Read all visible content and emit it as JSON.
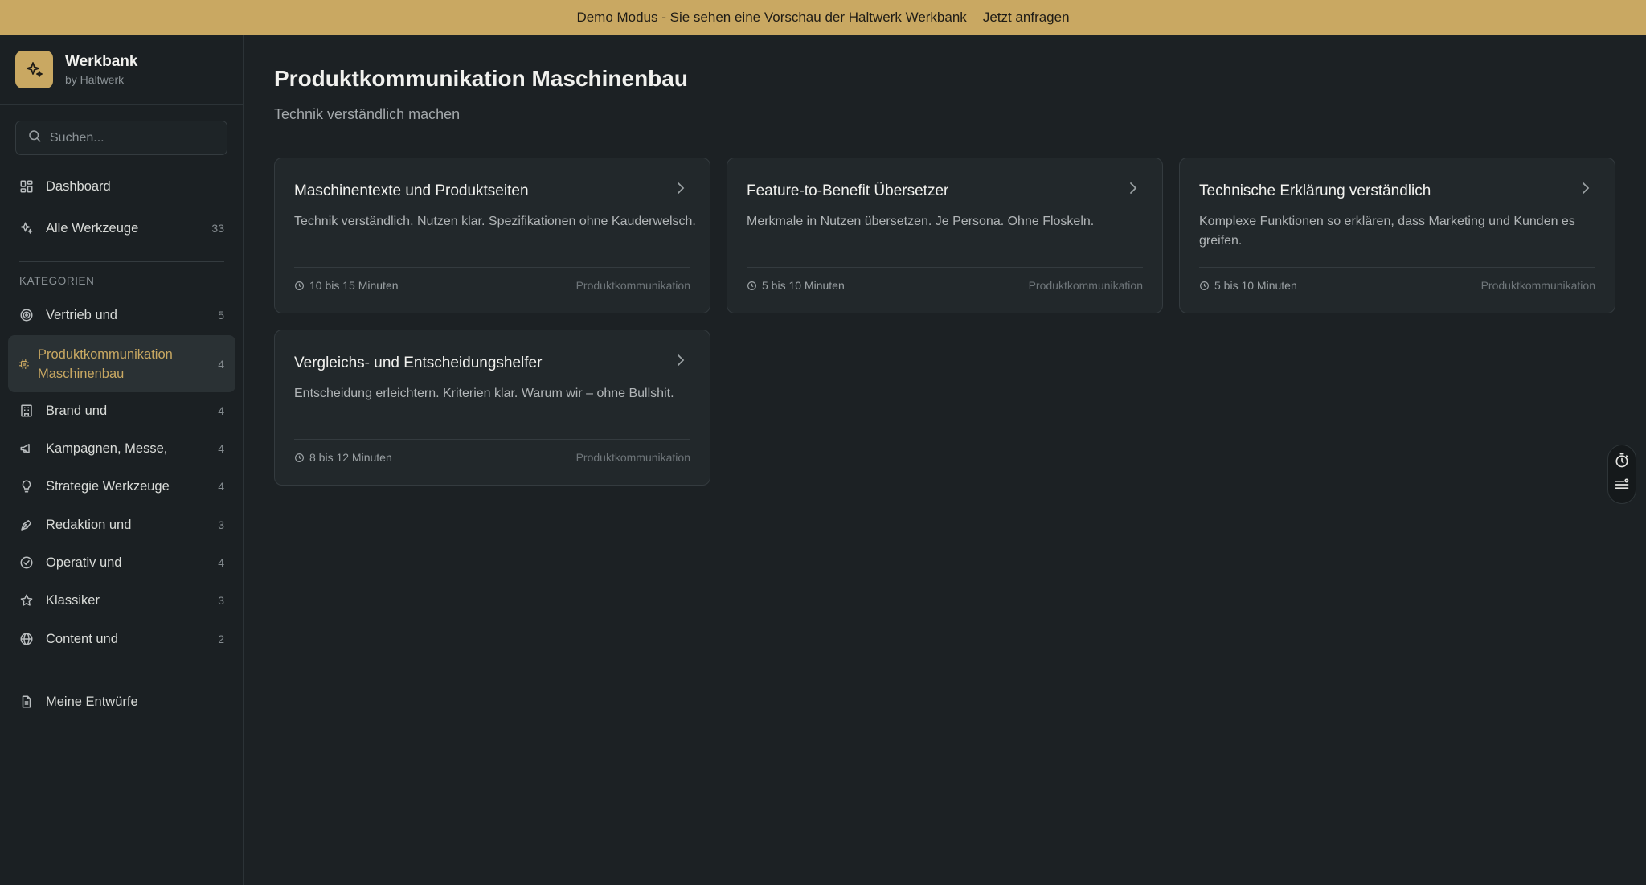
{
  "banner": {
    "text": "Demo Modus - Sie sehen eine Vorschau der Haltwerk Werkbank",
    "link": "Jetzt anfragen"
  },
  "brand": {
    "name": "Werkbank",
    "sub": "by Haltwerk"
  },
  "search": {
    "placeholder": "Suchen..."
  },
  "nav": {
    "dashboard": "Dashboard",
    "all_tools": {
      "label": "Alle Werkzeuge",
      "count": "33"
    },
    "section": "KATEGORIEN",
    "categories": [
      {
        "label": "Vertrieb und",
        "count": "5",
        "icon": "target-icon"
      },
      {
        "label": "Produktkommunikation Maschinenbau",
        "count": "4",
        "icon": "cpu-icon",
        "active": true
      },
      {
        "label": "Brand und",
        "count": "4",
        "icon": "building-icon"
      },
      {
        "label": "Kampagnen, Messe,",
        "count": "4",
        "icon": "megaphone-icon"
      },
      {
        "label": "Strategie Werkzeuge",
        "count": "4",
        "icon": "lightbulb-icon"
      },
      {
        "label": "Redaktion und",
        "count": "3",
        "icon": "pen-icon"
      },
      {
        "label": "Operativ und",
        "count": "4",
        "icon": "check-circle-icon"
      },
      {
        "label": "Klassiker",
        "count": "3",
        "icon": "star-icon"
      },
      {
        "label": "Content und",
        "count": "2",
        "icon": "globe-icon"
      }
    ],
    "drafts": "Meine Entwürfe"
  },
  "page": {
    "title": "Produktkommunikation Maschinenbau",
    "subtitle": "Technik verständlich machen"
  },
  "cards": [
    {
      "title": "Maschinentexte und Produktseiten",
      "desc": "Technik verständlich. Nutzen klar. Spezifikationen ohne Kauderwelsch.",
      "time": "10 bis 15 Minuten",
      "category": "Produktkommunikation"
    },
    {
      "title": "Feature-to-Benefit Übersetzer",
      "desc": "Merkmale in Nutzen übersetzen. Je Persona. Ohne Floskeln.",
      "time": "5 bis 10 Minuten",
      "category": "Produktkommunikation"
    },
    {
      "title": "Technische Erklärung verständlich",
      "desc": "Komplexe Funktionen so erklären, dass Marketing und Kunden es greifen.",
      "time": "5 bis 10 Minuten",
      "category": "Produktkommunikation"
    },
    {
      "title": "Vergleichs- und Entscheidungshelfer",
      "desc": "Entscheidung erleichtern. Kriterien klar. Warum wir – ohne Bullshit.",
      "time": "8 bis 12 Minuten",
      "category": "Produktkommunikation"
    }
  ],
  "colors": {
    "accent": "#c9a862",
    "background": "#1c2124",
    "card": "#22282b"
  }
}
